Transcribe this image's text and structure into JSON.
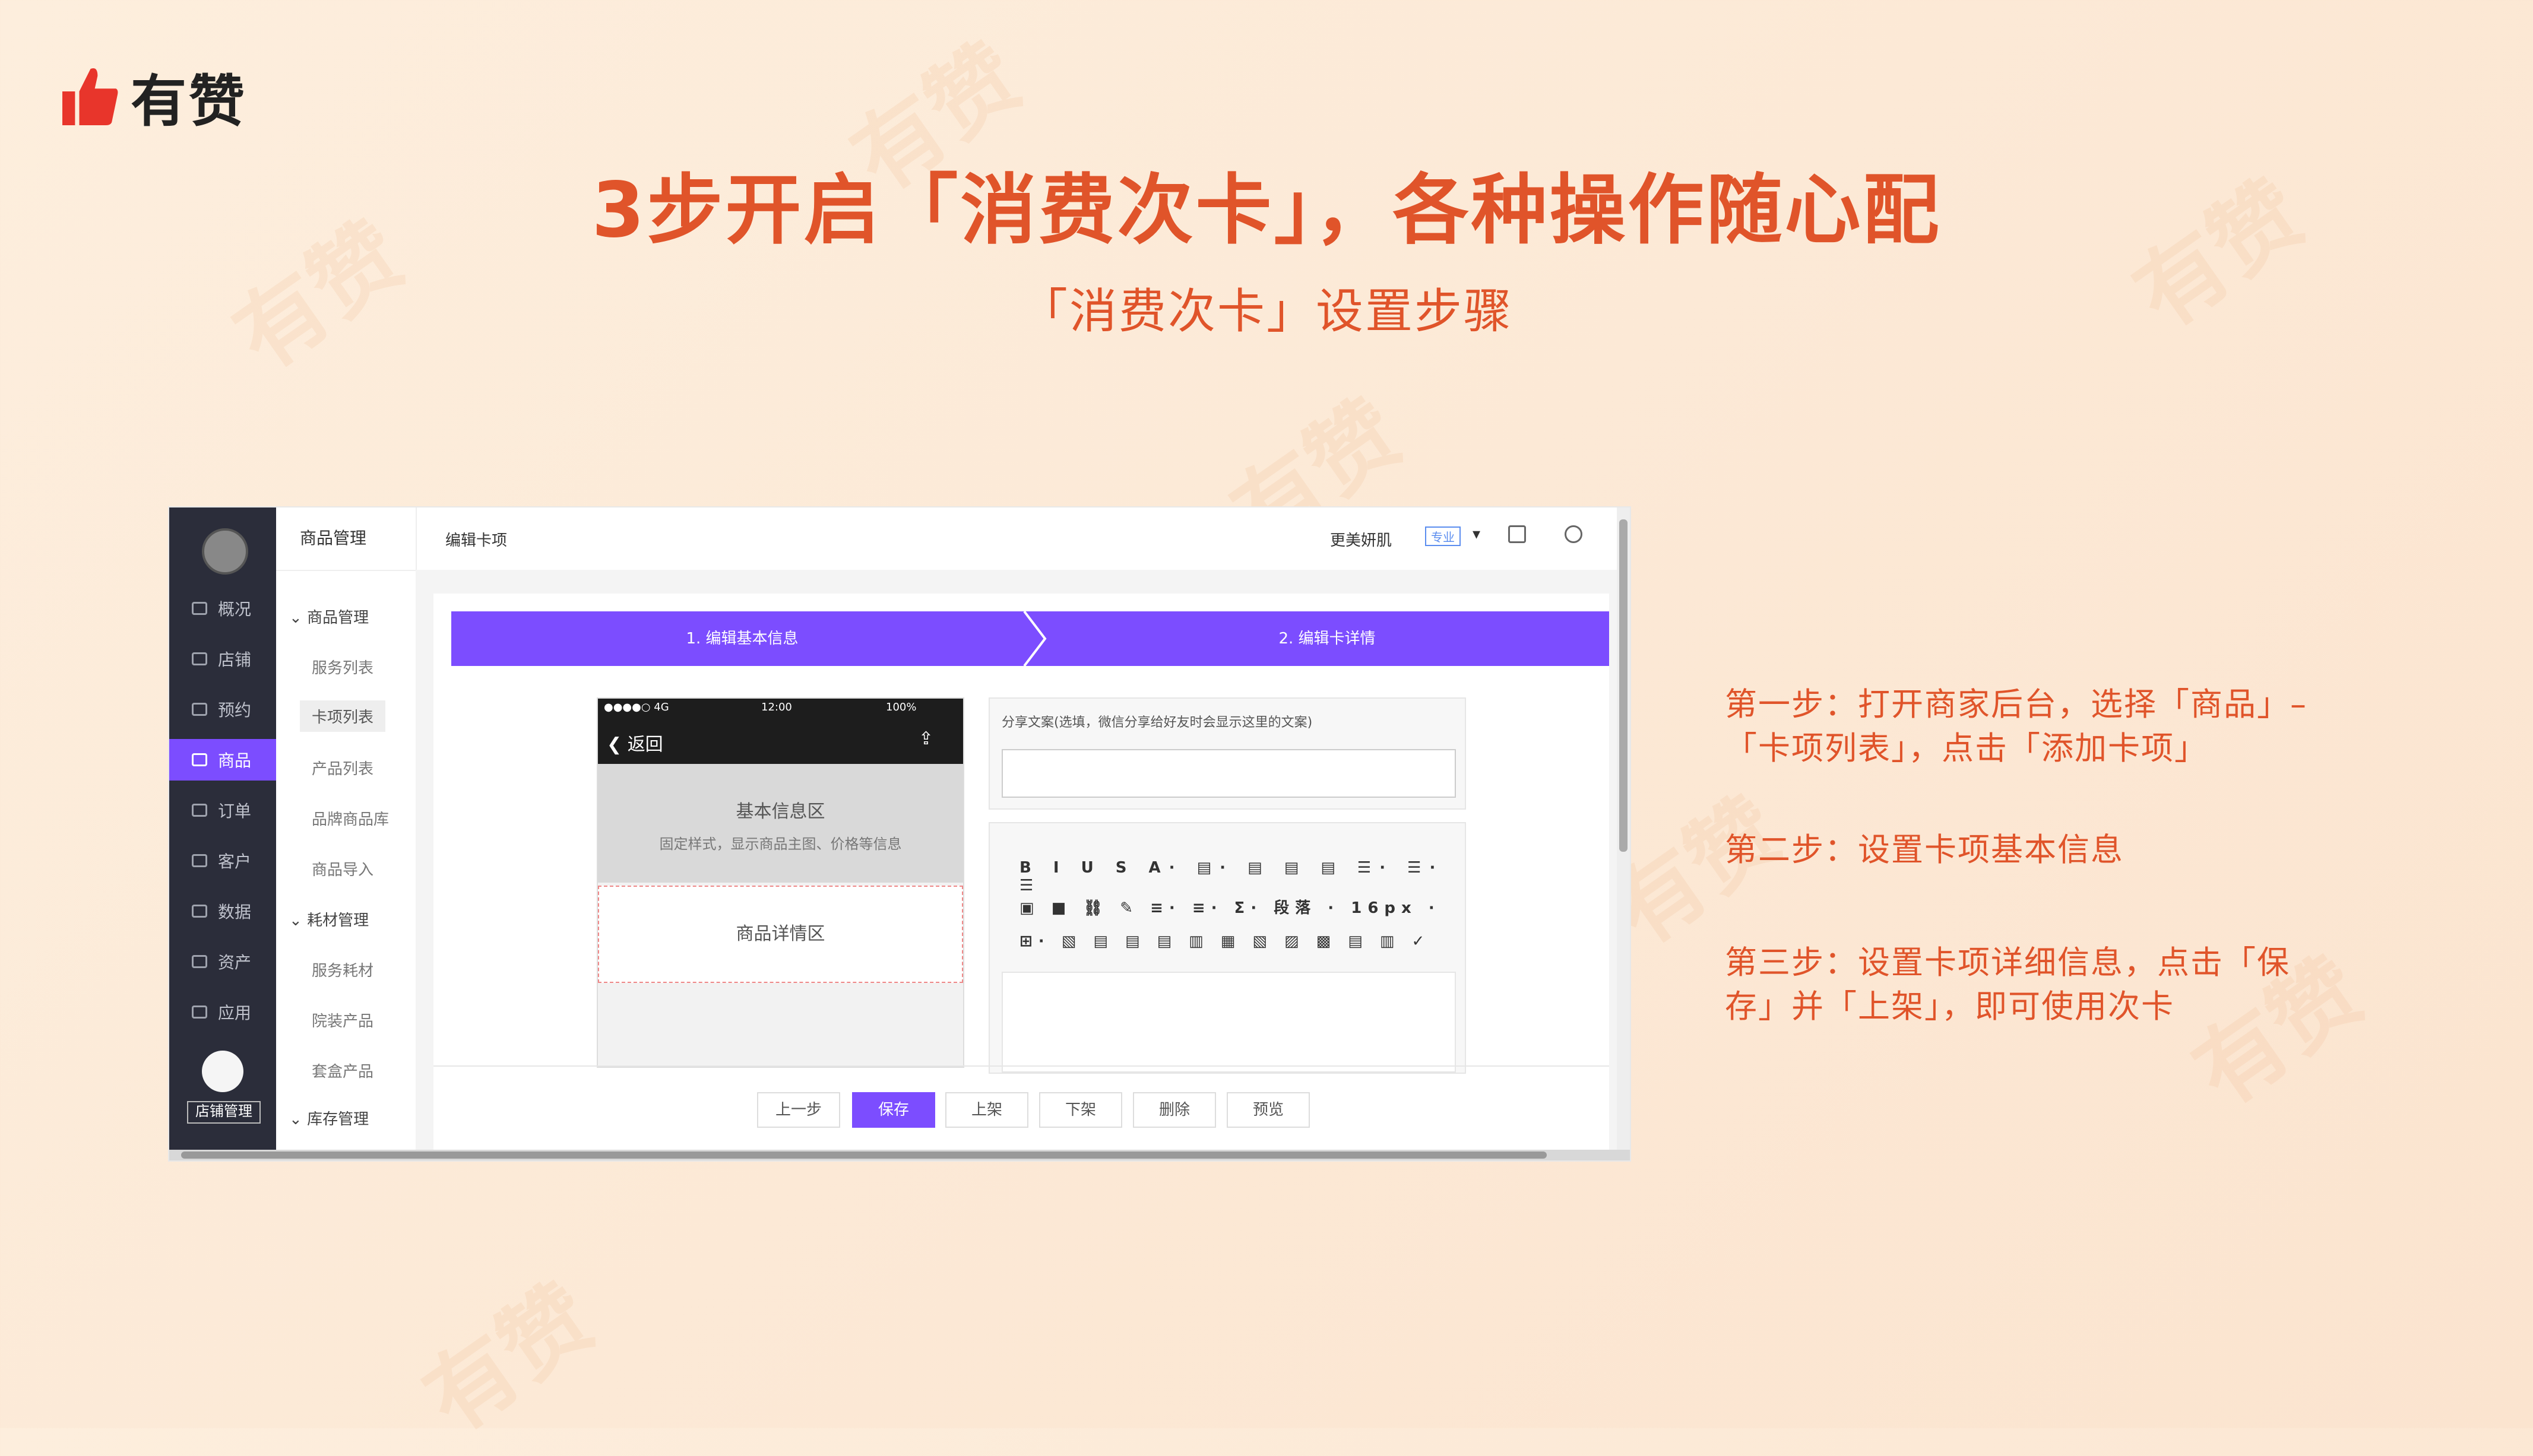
{
  "brand": {
    "name": "有赞"
  },
  "watermark": "有赞",
  "title": "3步开启「消费次卡」，各种操作随心配",
  "subtitle": "「消费次卡」设置步骤",
  "screenshot": {
    "sidebar_main": [
      {
        "label": "概况"
      },
      {
        "label": "店铺"
      },
      {
        "label": "预约"
      },
      {
        "label": "商品",
        "active": true
      },
      {
        "label": "订单"
      },
      {
        "label": "客户"
      },
      {
        "label": "数据"
      },
      {
        "label": "资产"
      },
      {
        "label": "应用"
      }
    ],
    "shop_button": "店铺管理",
    "sidebar_sub": {
      "header": "商品管理",
      "groups": [
        {
          "label": "商品管理",
          "items": [
            "服务列表",
            "卡项列表",
            "产品列表",
            "品牌商品库",
            "商品导入"
          ]
        },
        {
          "label": "耗材管理",
          "items": [
            "服务耗材",
            "院装产品",
            "套盒产品"
          ]
        },
        {
          "label": "库存管理",
          "items": []
        }
      ]
    },
    "topbar": {
      "breadcrumb": "编辑卡项",
      "shop_name": "更美妍肌",
      "badge": "专业"
    },
    "steps": [
      "1. 编辑基本信息",
      "2. 编辑卡详情"
    ],
    "phone": {
      "status_left": "●●●●○ 4G",
      "status_time": "12:00",
      "status_right": "100%",
      "back": "返回",
      "basic_title": "基本信息区",
      "basic_desc": "固定样式，显示商品主图、价格等信息",
      "detail_title": "商品详情区"
    },
    "share_label": "分享文案(选填，微信分享给好友时会显示这里的文案)",
    "toolbar_rows": [
      "B I U S A· ▤· ▤ ▤ ▤ ☰· ☰· ☰",
      "▣ ■ ⛓ ✎ ≡· ≡· Σ· 段落 · 16px ·",
      "⊞· ▧ ▤ ▤ ▤ ▥ ▦ ▧ ▨ ▩ ▤ ▥ ✓"
    ],
    "buttons": [
      "上一步",
      "保存",
      "上架",
      "下架",
      "删除",
      "预览"
    ]
  },
  "instructions": [
    [
      "第一步：打开商家后台，选择「商品」–",
      "「卡项列表」，点击「添加卡项」"
    ],
    [
      "第二步：设置卡项基本信息"
    ],
    [
      "第三步：设置卡项详细信息，点击「保",
      "存」并「上架」，即可使用次卡"
    ]
  ],
  "colors": {
    "accent": "#e0542a",
    "brand_red": "#e8352b",
    "purple": "#7c4dff"
  }
}
